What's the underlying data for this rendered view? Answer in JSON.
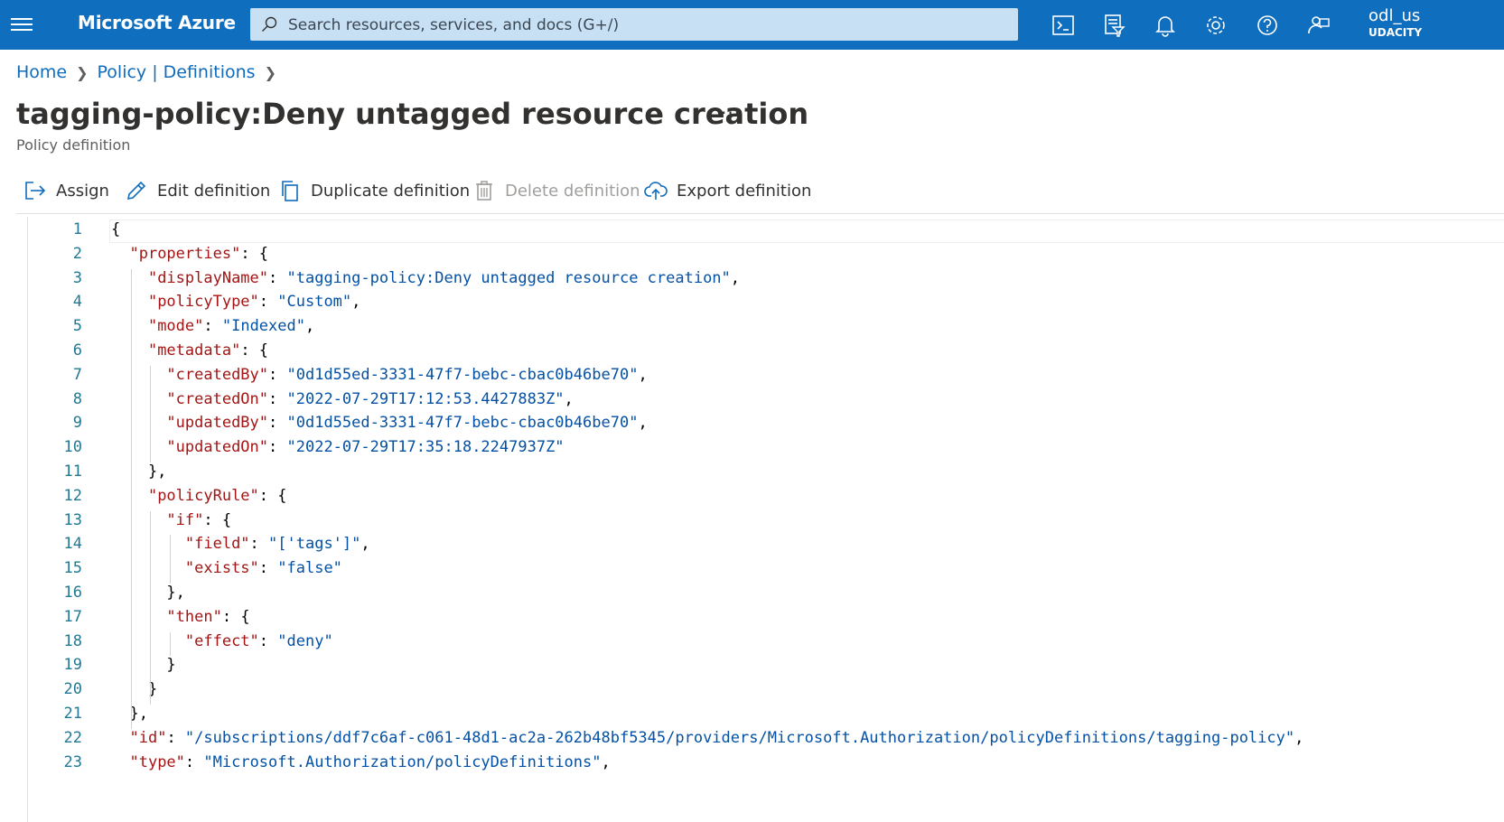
{
  "header": {
    "brand": "Microsoft Azure",
    "search_placeholder": "Search resources, services, and docs (G+/)",
    "account_name": "odl_us",
    "account_tenant": "UDACITY",
    "icons": [
      "cloud-shell-icon",
      "directory-filter-icon",
      "notifications-icon",
      "settings-icon",
      "help-icon",
      "feedback-icon"
    ],
    "bar_color": "#106ebe"
  },
  "breadcrumb": {
    "items": [
      "Home",
      "Policy | Definitions"
    ]
  },
  "page": {
    "title": "tagging-policy:Deny untagged resource creation",
    "more": "···",
    "subtitle": "Policy definition"
  },
  "toolbar": {
    "assign": "Assign",
    "edit": "Edit definition",
    "duplicate": "Duplicate definition",
    "delete": "Delete definition",
    "export": "Export definition"
  },
  "editor": {
    "lines": [
      [
        [
          "p",
          "{"
        ]
      ],
      [
        [
          "p",
          "  "
        ],
        [
          "k",
          "\"properties\""
        ],
        [
          "p",
          ": {"
        ]
      ],
      [
        [
          "p",
          "    "
        ],
        [
          "k",
          "\"displayName\""
        ],
        [
          "p",
          ": "
        ],
        [
          "s",
          "\"tagging-policy:Deny untagged resource creation\""
        ],
        [
          "p",
          ","
        ]
      ],
      [
        [
          "p",
          "    "
        ],
        [
          "k",
          "\"policyType\""
        ],
        [
          "p",
          ": "
        ],
        [
          "s",
          "\"Custom\""
        ],
        [
          "p",
          ","
        ]
      ],
      [
        [
          "p",
          "    "
        ],
        [
          "k",
          "\"mode\""
        ],
        [
          "p",
          ": "
        ],
        [
          "s",
          "\"Indexed\""
        ],
        [
          "p",
          ","
        ]
      ],
      [
        [
          "p",
          "    "
        ],
        [
          "k",
          "\"metadata\""
        ],
        [
          "p",
          ": {"
        ]
      ],
      [
        [
          "p",
          "      "
        ],
        [
          "k",
          "\"createdBy\""
        ],
        [
          "p",
          ": "
        ],
        [
          "s",
          "\"0d1d55ed-3331-47f7-bebc-cbac0b46be70\""
        ],
        [
          "p",
          ","
        ]
      ],
      [
        [
          "p",
          "      "
        ],
        [
          "k",
          "\"createdOn\""
        ],
        [
          "p",
          ": "
        ],
        [
          "s",
          "\"2022-07-29T17:12:53.4427883Z\""
        ],
        [
          "p",
          ","
        ]
      ],
      [
        [
          "p",
          "      "
        ],
        [
          "k",
          "\"updatedBy\""
        ],
        [
          "p",
          ": "
        ],
        [
          "s",
          "\"0d1d55ed-3331-47f7-bebc-cbac0b46be70\""
        ],
        [
          "p",
          ","
        ]
      ],
      [
        [
          "p",
          "      "
        ],
        [
          "k",
          "\"updatedOn\""
        ],
        [
          "p",
          ": "
        ],
        [
          "s",
          "\"2022-07-29T17:35:18.2247937Z\""
        ]
      ],
      [
        [
          "p",
          "    },"
        ]
      ],
      [
        [
          "p",
          "    "
        ],
        [
          "k",
          "\"policyRule\""
        ],
        [
          "p",
          ": {"
        ]
      ],
      [
        [
          "p",
          "      "
        ],
        [
          "k",
          "\"if\""
        ],
        [
          "p",
          ": {"
        ]
      ],
      [
        [
          "p",
          "        "
        ],
        [
          "k",
          "\"field\""
        ],
        [
          "p",
          ": "
        ],
        [
          "s",
          "\"['tags']\""
        ],
        [
          "p",
          ","
        ]
      ],
      [
        [
          "p",
          "        "
        ],
        [
          "k",
          "\"exists\""
        ],
        [
          "p",
          ": "
        ],
        [
          "s",
          "\"false\""
        ]
      ],
      [
        [
          "p",
          "      },"
        ]
      ],
      [
        [
          "p",
          "      "
        ],
        [
          "k",
          "\"then\""
        ],
        [
          "p",
          ": {"
        ]
      ],
      [
        [
          "p",
          "        "
        ],
        [
          "k",
          "\"effect\""
        ],
        [
          "p",
          ": "
        ],
        [
          "s",
          "\"deny\""
        ]
      ],
      [
        [
          "p",
          "      }"
        ]
      ],
      [
        [
          "p",
          "    }"
        ]
      ],
      [
        [
          "p",
          "  },"
        ]
      ],
      [
        [
          "p",
          "  "
        ],
        [
          "k",
          "\"id\""
        ],
        [
          "p",
          ": "
        ],
        [
          "s",
          "\"/subscriptions/ddf7c6af-c061-48d1-ac2a-262b48bf5345/providers/Microsoft.Authorization/policyDefinitions/tagging-policy\""
        ],
        [
          "p",
          ","
        ]
      ],
      [
        [
          "p",
          "  "
        ],
        [
          "k",
          "\"type\""
        ],
        [
          "p",
          ": "
        ],
        [
          "s",
          "\"Microsoft.Authorization/policyDefinitions\""
        ],
        [
          "p",
          ","
        ]
      ]
    ],
    "key_color": "#a31515",
    "string_color": "#0451a5",
    "line_number_color": "#237893"
  }
}
